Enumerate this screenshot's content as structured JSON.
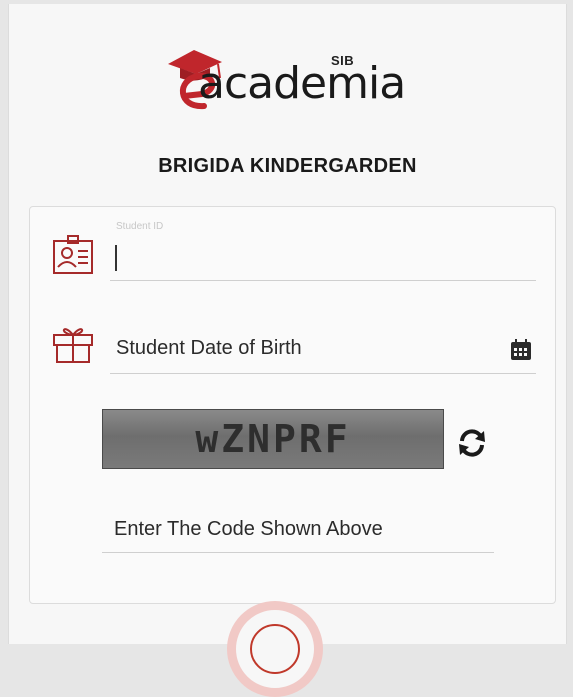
{
  "brand": {
    "sib": "SIB",
    "word": "academia",
    "accent_color": "#c0262c"
  },
  "school": {
    "name": "BRIGIDA KINDERGARDEN"
  },
  "form": {
    "student_id_label": "Student ID",
    "student_id_value": "",
    "dob_placeholder": "Student Date of Birth",
    "captcha_code": "wZNPRF",
    "code_placeholder": "Enter The Code Shown Above"
  },
  "icons": {
    "student_id": "id-card-icon",
    "dob": "gift-icon",
    "calendar": "calendar-icon",
    "refresh": "refresh-icon",
    "submit": "submit-icon"
  }
}
